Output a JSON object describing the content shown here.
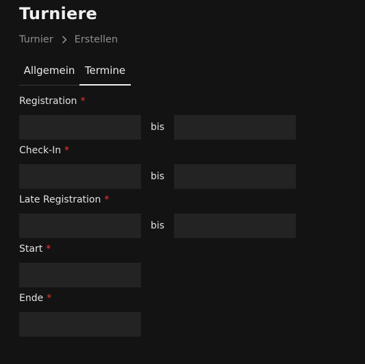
{
  "page": {
    "title": "Turniere"
  },
  "breadcrumb": {
    "items": [
      "Turnier",
      "Erstellen"
    ],
    "separator_icon": "chevron-right-icon"
  },
  "tabs": [
    {
      "label": "Allgemein",
      "active": false
    },
    {
      "label": "Termine",
      "active": true
    }
  ],
  "form": {
    "range_separator": "bis",
    "required_marker": "*",
    "required_color": "#e53935",
    "fields": {
      "registration": {
        "label": "Registration",
        "from_value": "",
        "to_value": ""
      },
      "checkin": {
        "label": "Check-In",
        "from_value": "",
        "to_value": ""
      },
      "late_registration": {
        "label": "Late Registration",
        "from_value": "",
        "to_value": ""
      },
      "start": {
        "label": "Start",
        "value": ""
      },
      "end": {
        "label": "Ende",
        "value": ""
      }
    }
  },
  "colors": {
    "background": "#131313",
    "input_background": "#232323",
    "text": "#ececec",
    "muted_text": "#8f8f8f",
    "active_tab_indicator": "#f2f2f2"
  }
}
